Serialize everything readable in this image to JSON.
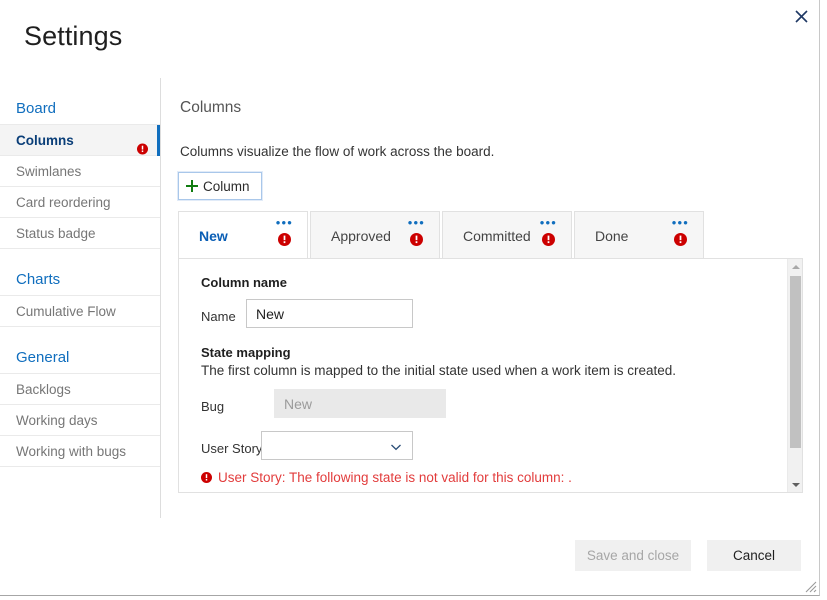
{
  "window": {
    "title": "Settings",
    "close_icon": "close-icon",
    "resize_grip": "resize-grip"
  },
  "colors": {
    "accent_blue": "#106ebe",
    "link_blue": "#0a5eb5",
    "error_red": "#e23c3c",
    "error_badge": "#cc0000",
    "plus_green": "#107c10",
    "selected_bg": "#f4f4f4",
    "tab_inactive_bg": "#f6f6f6",
    "disabled_field_bg": "#e9e9e9"
  },
  "sidebar": {
    "groups": [
      {
        "label": "Board",
        "items": [
          {
            "label": "Columns",
            "selected": true,
            "has_error": true
          },
          {
            "label": "Swimlanes",
            "selected": false,
            "has_error": false
          },
          {
            "label": "Card reordering",
            "selected": false,
            "has_error": false
          },
          {
            "label": "Status badge",
            "selected": false,
            "has_error": false
          }
        ]
      },
      {
        "label": "Charts",
        "items": [
          {
            "label": "Cumulative Flow",
            "selected": false,
            "has_error": false
          }
        ]
      },
      {
        "label": "General",
        "items": [
          {
            "label": "Backlogs",
            "selected": false,
            "has_error": false
          },
          {
            "label": "Working days",
            "selected": false,
            "has_error": false
          },
          {
            "label": "Working with bugs",
            "selected": false,
            "has_error": false
          }
        ]
      }
    ]
  },
  "main": {
    "section_title": "Columns",
    "description": "Columns visualize the flow of work across the board.",
    "add_column_label": "Column",
    "add_column_icon": "plus-icon",
    "tabs": [
      {
        "label": "New",
        "active": true,
        "has_error": true,
        "menu": "•••"
      },
      {
        "label": "Approved",
        "active": false,
        "has_error": true,
        "menu": "•••"
      },
      {
        "label": "Committed",
        "active": false,
        "has_error": true,
        "menu": "•••"
      },
      {
        "label": "Done",
        "active": false,
        "has_error": true,
        "menu": "•••"
      }
    ],
    "panel": {
      "column_name_heading": "Column name",
      "name_label": "Name",
      "name_value": "New",
      "state_mapping_heading": "State mapping",
      "state_mapping_desc": "The first column is mapped to the initial state used when a work item is created.",
      "bug_label": "Bug",
      "bug_value": "New",
      "user_story_label": "User Story",
      "user_story_value": "",
      "user_story_chevron_icon": "chevron-down-icon",
      "validation_message": "User Story: The following state is not valid for this column: .",
      "validation_icon": "error-icon"
    },
    "scrollbar": {
      "up_icon": "scroll-up-arrow-icon",
      "down_icon": "scroll-down-arrow-icon"
    }
  },
  "footer": {
    "save_label": "Save and close",
    "save_disabled": true,
    "cancel_label": "Cancel"
  }
}
